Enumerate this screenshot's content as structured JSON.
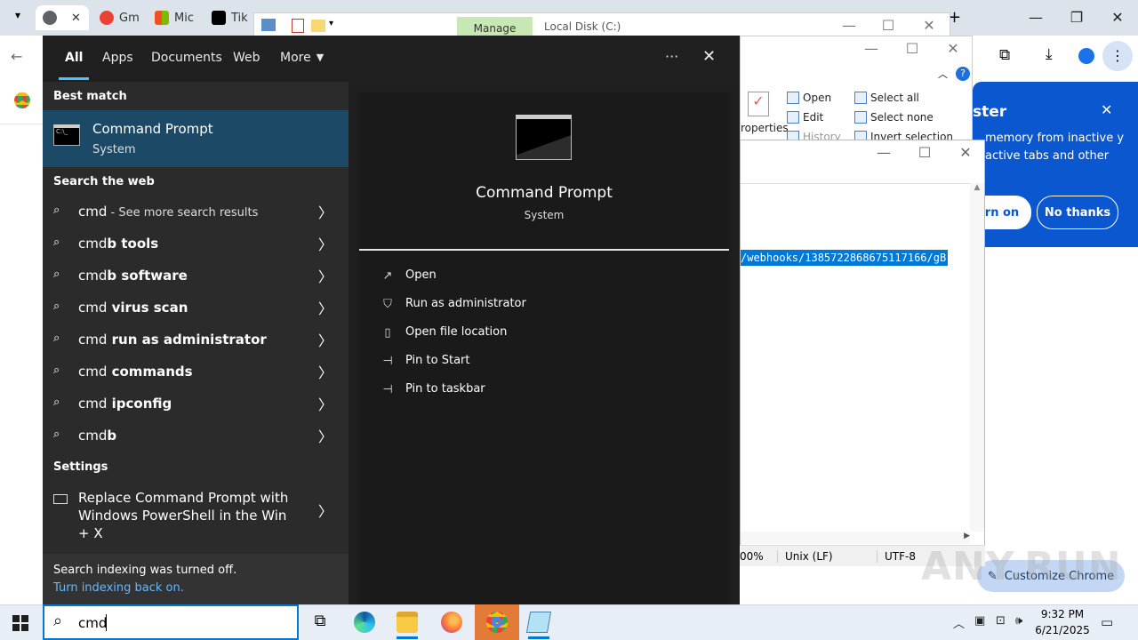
{
  "chrome": {
    "tabs": [
      {
        "label": "",
        "color": "#5f6368"
      },
      {
        "label": "Gm",
        "color": "#ea4335"
      },
      {
        "label": "Mic",
        "color": "#f25022"
      },
      {
        "label": "Tik",
        "color": "#000000"
      }
    ],
    "new_tab": "+",
    "popup": {
      "title": "ster",
      "body": "memory from inactive y active tabs and other",
      "turn_on": "rn on",
      "no_thanks": "No thanks"
    },
    "customize": "Customize Chrome"
  },
  "explorer": {
    "manage": "Manage",
    "title": "Local Disk (C:)",
    "ribbon": {
      "properties": "roperties",
      "open": "Open",
      "edit": "Edit",
      "history": "History",
      "select_all": "Select all",
      "select_none": "Select none",
      "invert_selection": "Invert selection"
    }
  },
  "notepad": {
    "selected_text": "/webhooks/1385722868675117166/gB",
    "status": {
      "zoom": "00%",
      "eol": "Unix (LF)",
      "encoding": "UTF-8"
    }
  },
  "start": {
    "tabs": [
      "All",
      "Apps",
      "Documents",
      "Web",
      "More"
    ],
    "best_match_title": "Best match",
    "best_match": {
      "name": "Command Prompt",
      "type": "System"
    },
    "web_title": "Search the web",
    "web_results": [
      {
        "prefix": "cmd",
        "bold": "",
        "suffix": " - See more search results"
      },
      {
        "prefix": "cmd",
        "bold": "b tools",
        "suffix": ""
      },
      {
        "prefix": "cmd",
        "bold": "b software",
        "suffix": ""
      },
      {
        "prefix": "cmd",
        "bold": " virus scan",
        "suffix": ""
      },
      {
        "prefix": "cmd",
        "bold": " run as administrator",
        "suffix": ""
      },
      {
        "prefix": "cmd",
        "bold": " commands",
        "suffix": ""
      },
      {
        "prefix": "cmd",
        "bold": " ipconfig",
        "suffix": ""
      },
      {
        "prefix": "cmd",
        "bold": "b",
        "suffix": ""
      }
    ],
    "settings_title": "Settings",
    "settings_item": "Replace Command Prompt with Windows PowerShell in the Win + X",
    "indexing_off": "Search indexing was turned off.",
    "indexing_link": "Turn indexing back on.",
    "preview": {
      "name": "Command Prompt",
      "type": "System"
    },
    "actions": [
      "Open",
      "Run as administrator",
      "Open file location",
      "Pin to Start",
      "Pin to taskbar"
    ]
  },
  "taskbar": {
    "search_value": "cmd",
    "time": "9:32 PM",
    "date": "6/21/2025"
  },
  "watermark": "ANY.RUN"
}
